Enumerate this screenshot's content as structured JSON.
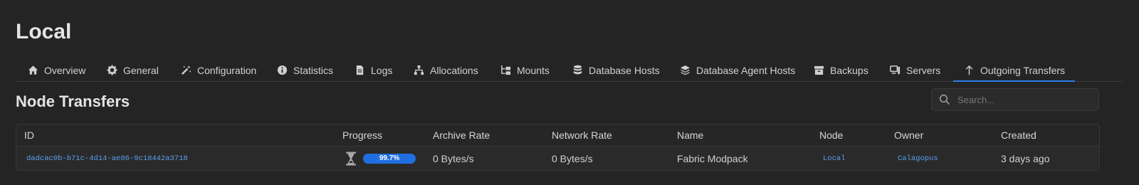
{
  "page": {
    "title": "Local"
  },
  "tabs": [
    {
      "label": "Overview",
      "icon": "home-icon"
    },
    {
      "label": "General",
      "icon": "gear-icon"
    },
    {
      "label": "Configuration",
      "icon": "wand-icon"
    },
    {
      "label": "Statistics",
      "icon": "info-icon"
    },
    {
      "label": "Logs",
      "icon": "file-icon"
    },
    {
      "label": "Allocations",
      "icon": "network-icon"
    },
    {
      "label": "Mounts",
      "icon": "folder-tree-icon"
    },
    {
      "label": "Database Hosts",
      "icon": "database-icon"
    },
    {
      "label": "Database Agent Hosts",
      "icon": "layers-icon"
    },
    {
      "label": "Backups",
      "icon": "archive-icon"
    },
    {
      "label": "Servers",
      "icon": "computer-icon"
    },
    {
      "label": "Outgoing Transfers",
      "icon": "arrow-up-icon",
      "active": true
    }
  ],
  "section": {
    "title": "Node Transfers"
  },
  "search": {
    "placeholder": "Search..."
  },
  "table": {
    "columns": [
      "ID",
      "Progress",
      "Archive Rate",
      "Network Rate",
      "Name",
      "Node",
      "Owner",
      "Created"
    ],
    "rows": [
      {
        "id": "dadcac0b-b71c-4d14-ae86-9c18442a3718",
        "progress_label": "99.7%",
        "progress": 0.997,
        "archive_rate": "0 Bytes/s",
        "network_rate": "0 Bytes/s",
        "name": "Fabric Modpack",
        "node": "Local",
        "owner": "Calagopus",
        "created": "3 days ago",
        "status_icon": "hourglass-icon"
      }
    ]
  },
  "colors": {
    "accent": "#2a7ae8",
    "link": "#5aa0f0",
    "background": "#242424"
  }
}
